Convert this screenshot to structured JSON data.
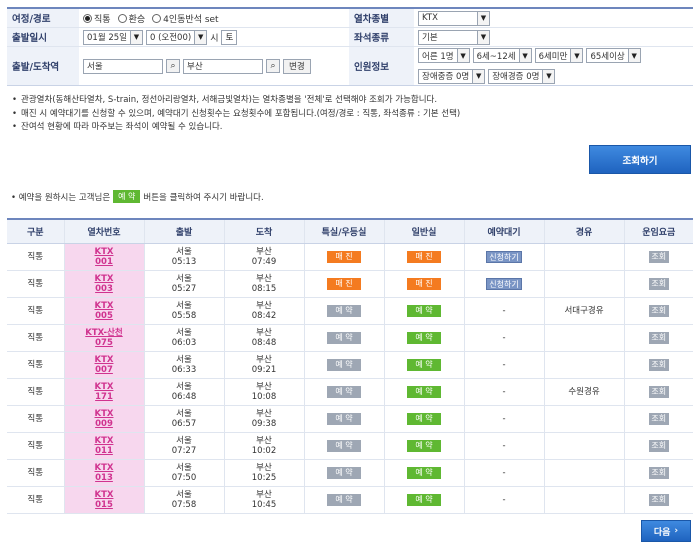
{
  "form": {
    "route_label": "여정/경로",
    "route_options": [
      "직통",
      "환승",
      "4인동반석 set"
    ],
    "route_selected": 0,
    "train_type_label": "열차종별",
    "train_type_value": "KTX",
    "depart_date_label": "출발일시",
    "date_value": "01월 25일",
    "hour_value": "0 (오전00)",
    "hour_suffix": "시",
    "day_of_week": "토",
    "seat_type_label": "좌석종류",
    "seat_type_value": "기본",
    "station_label": "출발/도착역",
    "depart_station": "서울",
    "arrive_station": "부산",
    "swap_label": "변경",
    "passenger_label": "인원정보",
    "passengers": [
      "어른 1명",
      "6세~12세",
      "6세미만",
      "65세이상",
      "장애중증 0명",
      "장애경증 0명"
    ]
  },
  "notes": [
    "관광열차(동해산타열차, S-train, 정선아리랑열차, 서해금빛열차)는 열차종별을 '전체'로 선택해야 조회가 가능합니다.",
    "매진 시 예약대기를 신청할 수 있으며, 예약대기 신청횟수는 요청횟수에 포함됩니다.(여정/경로 : 직통, 좌석종류 : 기본 선택)",
    "잔여석 현황에 따라 마주보는 좌석이 예약될 수 있습니다."
  ],
  "search_button": "조회하기",
  "guide": {
    "prefix": "• 예약을 원하시는 고객님은",
    "button": "예 약",
    "suffix": "버튼을 클릭하여 주시기 바랍니다."
  },
  "table": {
    "headers": [
      "구분",
      "열차번호",
      "출발",
      "도착",
      "특실/우등실",
      "일반실",
      "예약대기",
      "경유",
      "운임요금"
    ],
    "rows": [
      {
        "type": "직통",
        "train1": "KTX",
        "train2": "001",
        "dep_st": "서울",
        "dep_t": "05:13",
        "arr_st": "부산",
        "arr_t": "07:49",
        "first": "매 진",
        "first_s": "sold",
        "std": "매 진",
        "std_s": "sold",
        "wait": "신청하기",
        "via": "",
        "fare": "조회"
      },
      {
        "type": "직통",
        "train1": "KTX",
        "train2": "003",
        "dep_st": "서울",
        "dep_t": "05:27",
        "arr_st": "부산",
        "arr_t": "08:15",
        "first": "매 진",
        "first_s": "sold",
        "std": "매 진",
        "std_s": "sold",
        "wait": "신청하기",
        "via": "",
        "fare": "조회"
      },
      {
        "type": "직통",
        "train1": "KTX",
        "train2": "005",
        "dep_st": "서울",
        "dep_t": "05:58",
        "arr_st": "부산",
        "arr_t": "08:42",
        "first": "예 약",
        "first_s": "gray",
        "std": "예 약",
        "std_s": "green",
        "wait": "-",
        "via": "서대구경유",
        "fare": "조회"
      },
      {
        "type": "직통",
        "train1": "KTX-산천",
        "train2": "075",
        "dep_st": "서울",
        "dep_t": "06:03",
        "arr_st": "부산",
        "arr_t": "08:48",
        "first": "예 약",
        "first_s": "gray",
        "std": "예 약",
        "std_s": "green",
        "wait": "-",
        "via": "",
        "fare": "조회"
      },
      {
        "type": "직통",
        "train1": "KTX",
        "train2": "007",
        "dep_st": "서울",
        "dep_t": "06:33",
        "arr_st": "부산",
        "arr_t": "09:21",
        "first": "예 약",
        "first_s": "gray",
        "std": "예 약",
        "std_s": "green",
        "wait": "-",
        "via": "",
        "fare": "조회"
      },
      {
        "type": "직통",
        "train1": "KTX",
        "train2": "171",
        "dep_st": "서울",
        "dep_t": "06:48",
        "arr_st": "부산",
        "arr_t": "10:08",
        "first": "예 약",
        "first_s": "gray",
        "std": "예 약",
        "std_s": "green",
        "wait": "-",
        "via": "수원경유",
        "fare": "조회"
      },
      {
        "type": "직통",
        "train1": "KTX",
        "train2": "009",
        "dep_st": "서울",
        "dep_t": "06:57",
        "arr_st": "부산",
        "arr_t": "09:38",
        "first": "예 약",
        "first_s": "gray",
        "std": "예 약",
        "std_s": "green",
        "wait": "-",
        "via": "",
        "fare": "조회"
      },
      {
        "type": "직통",
        "train1": "KTX",
        "train2": "011",
        "dep_st": "서울",
        "dep_t": "07:27",
        "arr_st": "부산",
        "arr_t": "10:02",
        "first": "예 약",
        "first_s": "gray",
        "std": "예 약",
        "std_s": "green",
        "wait": "-",
        "via": "",
        "fare": "조회"
      },
      {
        "type": "직통",
        "train1": "KTX",
        "train2": "013",
        "dep_st": "서울",
        "dep_t": "07:50",
        "arr_st": "부산",
        "arr_t": "10:25",
        "first": "예 약",
        "first_s": "gray",
        "std": "예 약",
        "std_s": "green",
        "wait": "-",
        "via": "",
        "fare": "조회"
      },
      {
        "type": "직통",
        "train1": "KTX",
        "train2": "015",
        "dep_st": "서울",
        "dep_t": "07:58",
        "arr_st": "부산",
        "arr_t": "10:45",
        "first": "예 약",
        "first_s": "gray",
        "std": "예 약",
        "std_s": "green",
        "wait": "-",
        "via": "",
        "fare": "조회"
      }
    ]
  },
  "next_button": "다음",
  "colors": {
    "accent": "#1f63bf",
    "sold": "#f47b20",
    "reserve": "#5fb832",
    "train_cell": "#f7d7ee"
  }
}
